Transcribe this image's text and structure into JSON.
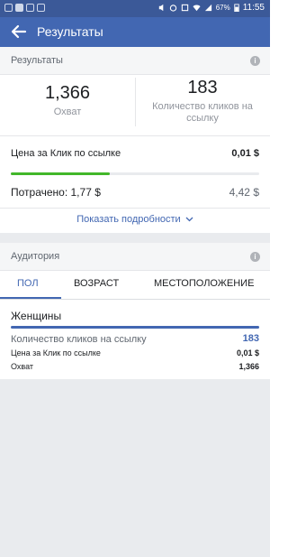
{
  "status_bar": {
    "battery_percent": "67%",
    "time": "11:55",
    "background": "#3b5998"
  },
  "app_bar": {
    "title": "Результаты",
    "back_icon": "arrow-left-icon",
    "background": "#4267b2"
  },
  "results": {
    "header": "Результаты",
    "reach": {
      "value": "1,366",
      "label": "Охват"
    },
    "link_clicks": {
      "value": "183",
      "label": "Количество кликов на ссылку"
    },
    "cost_per_click": {
      "label": "Цена за Клик по ссылке",
      "value": "0,01 $"
    },
    "budget_progress_fraction": 0.4,
    "spent": {
      "label": "Потрачено: 1,77 $",
      "total": "4,42 $"
    },
    "show_details": "Показать подробности"
  },
  "audience": {
    "header": "Аудитория",
    "tabs": [
      {
        "label": "ПОЛ",
        "active": true
      },
      {
        "label": "ВОЗРАСТ",
        "active": false
      },
      {
        "label": "МЕСТОПОЛОЖЕНИЕ",
        "active": false
      }
    ],
    "women": {
      "title": "Женщины",
      "link_clicks": {
        "label": "Количество кликов на ссылку",
        "value": "183"
      },
      "cost_per_click": {
        "label": "Цена за Клик по ссылке",
        "value": "0,01 $"
      },
      "reach": {
        "label": "Охват",
        "value": "1,366"
      }
    }
  },
  "colors": {
    "accent": "#4267b2",
    "progress": "#42b72a"
  }
}
